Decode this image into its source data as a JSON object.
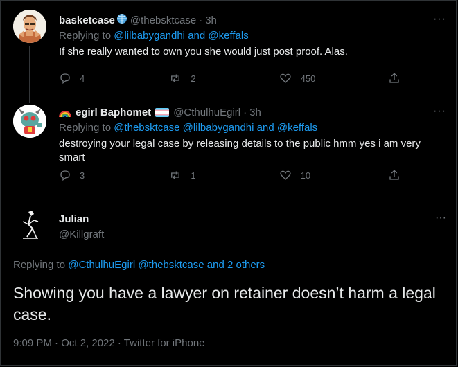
{
  "tweets": [
    {
      "name": "basketcase",
      "handle": "@thebsktcase",
      "dot": "·",
      "time": "3h",
      "more": "···",
      "replying_prefix": "Replying to",
      "replying_mentions": [
        "@lilbabygandhi",
        "and",
        "@keffals"
      ],
      "text": "If she really wanted to own you she would just post proof. Alas.",
      "replies": "4",
      "retweets": "2",
      "likes": "450",
      "icons": {
        "reply": "comment-icon",
        "retweet": "retweet-icon",
        "like": "heart-icon",
        "share": "share-icon",
        "badge": "globe-emoji-icon"
      }
    },
    {
      "name": "egirl Baphomet",
      "handle": "@CthulhuEgirl",
      "dot": "·",
      "time": "3h",
      "more": "···",
      "replying_prefix": "Replying to",
      "replying_mentions": [
        "@thebsktcase",
        "@lilbabygandhi",
        "and",
        "@keffals"
      ],
      "text": "destroying your legal case by releasing details to the public hmm yes i am very smart",
      "replies": "3",
      "retweets": "1",
      "likes": "10",
      "icons": {
        "prefix": "rainbow-emoji-icon",
        "flag": "trans-flag-icon"
      }
    }
  ],
  "main_tweet": {
    "name": "Julian",
    "handle": "@Killgraft",
    "more": "···",
    "replying_prefix": "Replying to",
    "replying_mentions": [
      "@CthulhuEgirl",
      "@thebsktcase",
      "and 2 others"
    ],
    "text": "Showing you have a lawyer on retainer doesn’t harm a legal case.",
    "meta": "9:09 PM · Oct 2, 2022 · Twitter for iPhone"
  },
  "colors": {
    "background": "#000000",
    "text": "#e7e9ea",
    "muted": "#71767b",
    "link": "#1d9bf0",
    "divider": "#2f3336"
  }
}
